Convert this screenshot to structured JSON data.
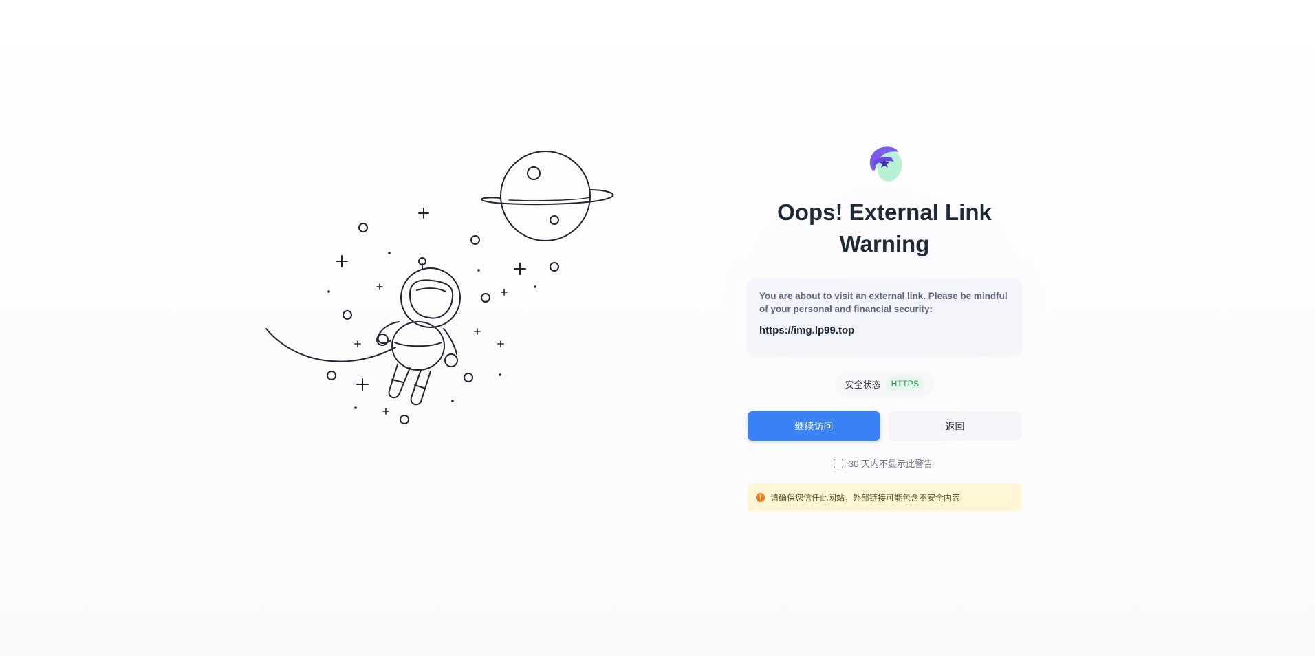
{
  "colors": {
    "primary": "#3b82f6",
    "title": "#1f2937",
    "https_green": "#16a34a",
    "warning_bg": "#fff6d6",
    "warning_icon": "#e67e22",
    "logo_purple": "#7c5cf0",
    "logo_mint": "#b8f2d5"
  },
  "illustration": {
    "icon": "astronaut-planet-icon"
  },
  "logo": {
    "icon": "star-hat-mascot-icon"
  },
  "title": {
    "line1": "Oops! External Link",
    "line2": "Warning"
  },
  "info": {
    "message": "You are about to visit an external link. Please be mindful of your personal and financial security:",
    "url": "https://img.lp99.top"
  },
  "security_status": {
    "label": "安全状态",
    "badge": "HTTPS"
  },
  "actions": {
    "continue_label": "继续访问",
    "back_label": "返回"
  },
  "dont_show": {
    "label": "30 天内不显示此警告",
    "checked": false
  },
  "warning": {
    "icon": "exclamation-circle-icon",
    "text": "请确保您信任此网站，外部链接可能包含不安全内容"
  }
}
